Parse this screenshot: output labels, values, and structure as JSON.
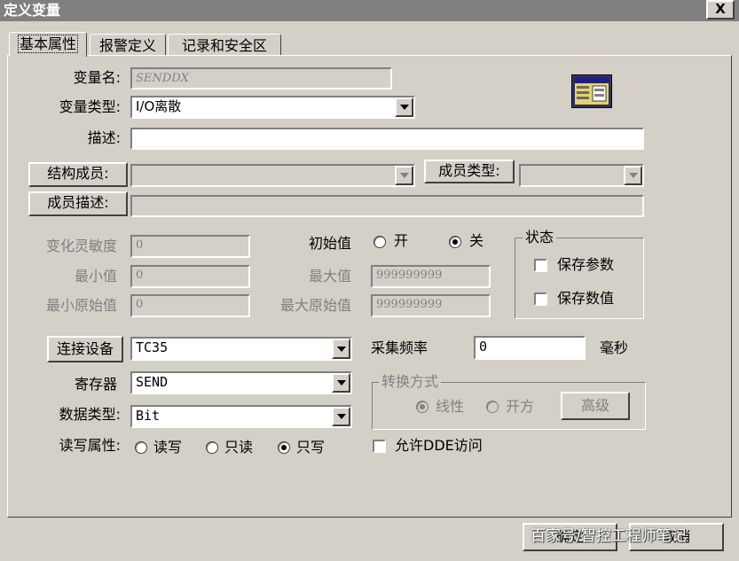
{
  "window": {
    "title": "定义变量",
    "close_glyph": "X"
  },
  "tabs": [
    {
      "label": "基本属性",
      "active": true
    },
    {
      "label": "报警定义",
      "active": false
    },
    {
      "label": "记录和安全区",
      "active": false
    }
  ],
  "icon": "table-window-icon",
  "basic": {
    "var_name_label": "变量名:",
    "var_name_value": "SENDDX",
    "var_type_label": "变量类型:",
    "var_type_value": "I/O离散",
    "desc_label": "描述:",
    "desc_value": "",
    "struct_member_label": "结构成员:",
    "struct_member_value": "",
    "member_type_label": "成员类型:",
    "member_type_value": "",
    "member_desc_label": "成员描述:",
    "member_desc_value": ""
  },
  "range": {
    "sensitivity_label": "变化灵敏度",
    "sensitivity_value": "0",
    "min_label": "最小值",
    "min_value": "0",
    "raw_min_label": "最小原始值",
    "raw_min_value": "0",
    "initial_label": "初始值",
    "initial_on_label": "开",
    "initial_off_label": "关",
    "initial_selected": "关",
    "max_label": "最大值",
    "max_value": "999999999",
    "raw_max_label": "最大原始值",
    "raw_max_value": "999999999"
  },
  "status": {
    "title": "状态",
    "save_params_label": "保存参数",
    "save_params_checked": false,
    "save_value_label": "保存数值",
    "save_value_checked": false
  },
  "io": {
    "connect_button": "连接设备",
    "device_value": "TC35",
    "register_label": "寄存器",
    "register_value": "SEND",
    "data_type_label": "数据类型:",
    "data_type_value": "Bit",
    "rw_label": "读写属性:",
    "rw_options": [
      "读写",
      "只读",
      "只写"
    ],
    "rw_selected": "只写",
    "sample_label": "采集频率",
    "sample_value": "0",
    "sample_unit": "毫秒",
    "convert_title": "转换方式",
    "convert_linear": "线性",
    "convert_sqrt": "开方",
    "convert_selected": "线性",
    "advanced_button": "高级",
    "dde_label": "允许DDE访问",
    "dde_checked": false
  },
  "footer": {
    "ok_button": "确定",
    "cancel_button": "取消",
    "watermark": "百家号/智控工程师笔记"
  },
  "colors": {
    "dialog_bg": "#d4d0c8",
    "titlebar": "#808080",
    "disabled_text": "#808080"
  }
}
